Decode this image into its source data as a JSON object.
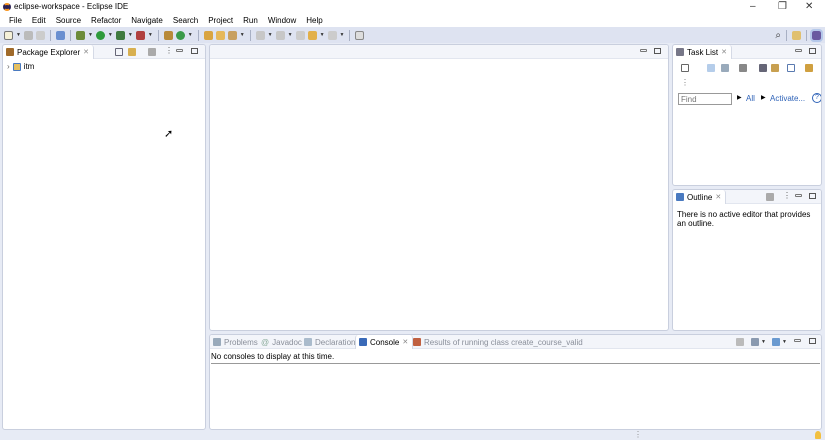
{
  "window": {
    "title": "eclipse-workspace - Eclipse IDE",
    "minimize": "–",
    "restore": "❐",
    "close": "✕"
  },
  "menu": [
    "File",
    "Edit",
    "Source",
    "Refactor",
    "Navigate",
    "Search",
    "Project",
    "Run",
    "Window",
    "Help"
  ],
  "package_explorer": {
    "title": "Package Explorer",
    "tree": [
      {
        "label": "itm",
        "expander": "›"
      }
    ]
  },
  "task_list": {
    "title": "Task List",
    "find_placeholder": "Find",
    "all": "All",
    "activate": "Activate...",
    "help": "?"
  },
  "outline": {
    "title": "Outline",
    "message": "There is no active editor that provides an outline."
  },
  "bottom": {
    "tabs": [
      "Problems",
      "Javadoc",
      "Declaration",
      "Console",
      "Results of running class create_course_valid"
    ],
    "active": "Console",
    "message": "No consoles to display at this time."
  },
  "colors": {
    "accent": "#2f63b8",
    "workbench": "#e7ebf5",
    "toolbar": "#dee3f1"
  }
}
